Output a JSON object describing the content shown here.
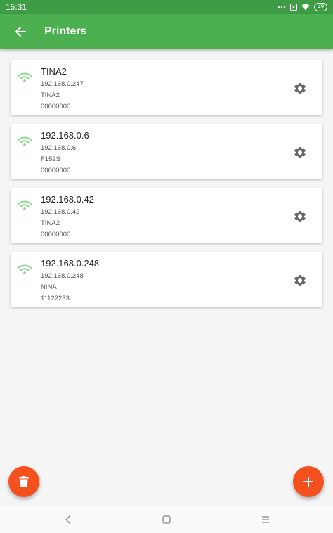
{
  "status_bar": {
    "time": "15:31",
    "battery": "49"
  },
  "app_bar": {
    "title": "Printers"
  },
  "printers": [
    {
      "name": "TINA2",
      "ip": "192.168.0.247",
      "model": "TINA2",
      "serial": "00000000"
    },
    {
      "name": "192.168.0.6",
      "ip": "192.168.0.6",
      "model": "F152S",
      "serial": "00000000"
    },
    {
      "name": "192.168.0.42",
      "ip": "192.168.0.42",
      "model": "TINA2",
      "serial": "00000000"
    },
    {
      "name": "192.168.0.248",
      "ip": "192.168.0.248",
      "model": "NINA",
      "serial": "11122233"
    }
  ],
  "colors": {
    "primary": "#4caf50",
    "status_bar": "#3e9c44",
    "fab": "#f4511e",
    "wifi": "#8fd18f"
  },
  "icons": {
    "back": "arrow-left-icon",
    "wifi": "wifi-icon",
    "settings": "gear-icon",
    "delete": "trash-icon",
    "add": "plus-icon"
  }
}
